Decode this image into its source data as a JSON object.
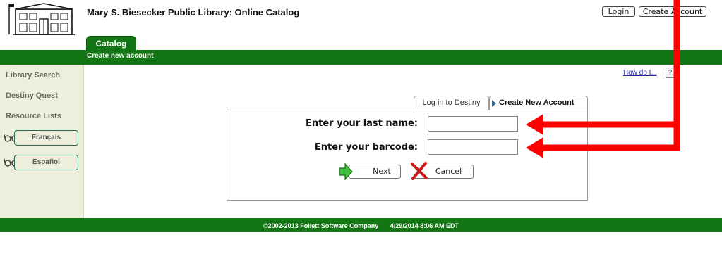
{
  "header": {
    "site_title": "Mary S. Biesecker Public Library: Online Catalog",
    "login_label": "Login",
    "create_account_label": "Create Account"
  },
  "nav": {
    "active_tab": "Catalog",
    "subtitle": "Create new account"
  },
  "sidebar": {
    "links": [
      "Library Search",
      "Destiny Quest",
      "Resource Lists"
    ],
    "languages": [
      "Français",
      "Español"
    ]
  },
  "help": {
    "link_label": "How do I...",
    "icon_label": "?"
  },
  "tabs": {
    "login": "Log in to Destiny",
    "create": "Create New Account"
  },
  "form": {
    "last_name_label": "Enter your last name:",
    "last_name_value": "",
    "barcode_label": "Enter your barcode:",
    "barcode_value": "",
    "next_label": "Next",
    "cancel_label": "Cancel"
  },
  "footer": {
    "copyright": "©2002-2013  Follett Software Company",
    "timestamp": "4/29/2014 8:06 AM EDT"
  },
  "colors": {
    "brand_green": "#137513",
    "annotation_red": "#ff0000",
    "sidebar_bg": "#eeeedc"
  }
}
